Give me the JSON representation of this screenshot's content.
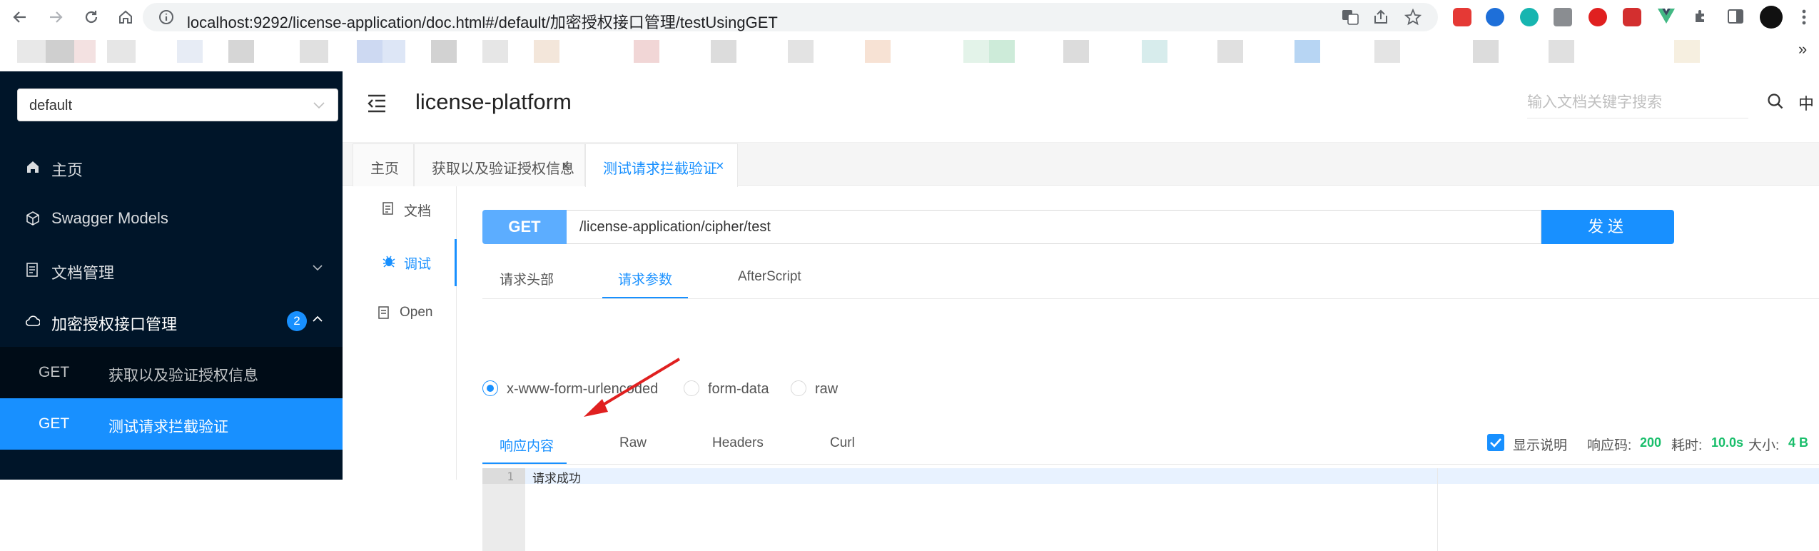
{
  "browser": {
    "url": "localhost:9292/license-application/doc.html#/default/加密授权接口管理/testUsingGET",
    "more_bookmarks": "»"
  },
  "sidebar": {
    "group_select": "default",
    "menu": [
      {
        "label": "主页",
        "icon": "home-icon"
      },
      {
        "label": "Swagger Models",
        "icon": "cube-icon"
      },
      {
        "label": "文档管理",
        "icon": "doc-icon"
      },
      {
        "label": "加密授权接口管理",
        "icon": "cloud-icon",
        "badge": "2"
      }
    ],
    "sub_items": [
      {
        "method": "GET",
        "title": "获取以及验证授权信息"
      },
      {
        "method": "GET",
        "title": "测试请求拦截验证"
      }
    ]
  },
  "header": {
    "title": "license-platform",
    "search_placeholder": "输入文档关键字搜索",
    "lang": "中"
  },
  "tabs": [
    {
      "label": "主页"
    },
    {
      "label": "获取以及验证授权信息",
      "close": "×"
    },
    {
      "label": "测试请求拦截验证",
      "close": "×"
    }
  ],
  "side_tabs": [
    {
      "label": "文档"
    },
    {
      "label": "调试"
    },
    {
      "label": "Open"
    }
  ],
  "request": {
    "method": "GET",
    "path": "/license-application/cipher/test",
    "send": "发送"
  },
  "param_tabs": [
    "请求头部",
    "请求参数",
    "AfterScript"
  ],
  "content_types": [
    "x-www-form-urlencoded",
    "form-data",
    "raw"
  ],
  "response_tabs": [
    "响应内容",
    "Raw",
    "Headers",
    "Curl"
  ],
  "response_meta": {
    "show_desc": "显示说明",
    "code_label": "响应码:",
    "code": "200",
    "time_label": "耗时:",
    "time": "10.0s",
    "size_label": "大小:",
    "size": "4 B"
  },
  "editor": {
    "line": "1",
    "text": "请求成功"
  },
  "colors": {
    "primary": "#1890ff",
    "sidebar": "#001529",
    "get": "#5cadff",
    "success": "#19be6b",
    "annotation_arrow": "#e02020"
  }
}
